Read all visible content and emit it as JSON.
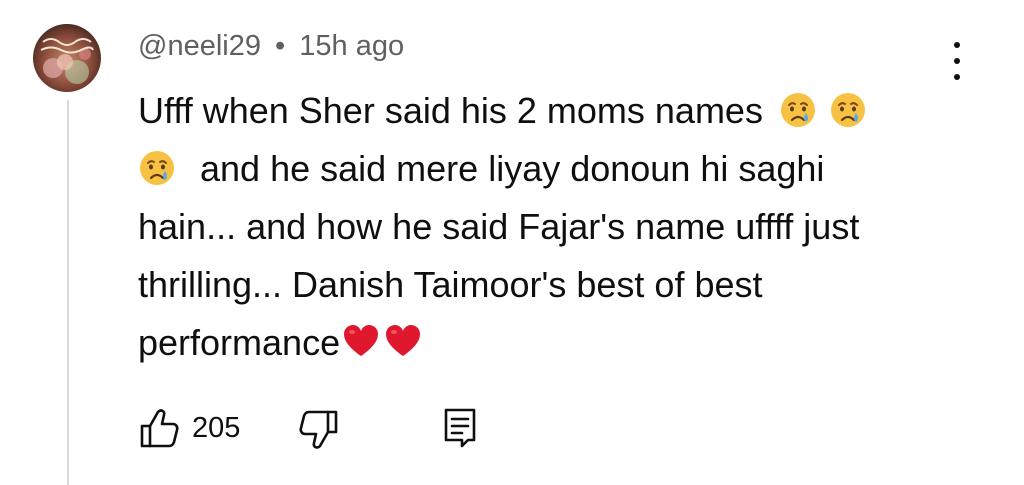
{
  "comment": {
    "author": "@neeli29",
    "separator": "•",
    "timestamp": "15h ago",
    "lines": [
      "Ufff when Sher said his 2 moms names",
      "and he said mere liyay donoun hi saghi",
      "hain... and how he said Fajar's name uffff just",
      "thrilling... Danish Taimoor's best of best",
      "performance"
    ],
    "like_count": "205"
  },
  "icons": {
    "menu": "kebab-menu-icon",
    "like": "thumbs-up-icon",
    "dislike": "thumbs-down-icon",
    "reply": "reply-comment-icon",
    "emoji_sad": "crying-face-emoji",
    "emoji_heart": "red-heart-emoji"
  },
  "colors": {
    "text": "#0f0f0f",
    "meta": "#606060",
    "heart": "#e0182d",
    "emoji_face": "#f7c244"
  }
}
